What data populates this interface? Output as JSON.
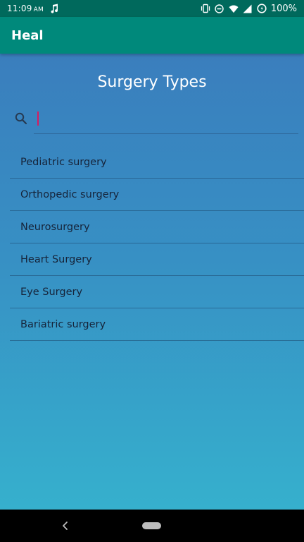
{
  "status_bar": {
    "time": "11:09",
    "ampm": "AM",
    "battery_percent": "100%",
    "icons": [
      "music-note-icon",
      "vibrate-icon",
      "do-not-disturb-icon",
      "wifi-icon",
      "cell-signal-icon",
      "battery-saver-icon"
    ]
  },
  "app_bar": {
    "title": "Heal"
  },
  "page": {
    "title": "Surgery Types",
    "search": {
      "value": "",
      "placeholder": ""
    }
  },
  "surgery_types": [
    "Pediatric surgery",
    "Orthopedic surgery",
    "Neurosurgery",
    "Heart Surgery",
    "Eye Surgery",
    "Bariatric surgery"
  ],
  "nav_bar": {
    "icons": [
      "back-icon",
      "home-pill-icon"
    ]
  },
  "colors": {
    "status_bar": "#00695c",
    "app_bar": "#00897b",
    "gradient_top": "#3a7ebd",
    "gradient_bottom": "#36b0cd",
    "cursor": "#d81b60"
  }
}
